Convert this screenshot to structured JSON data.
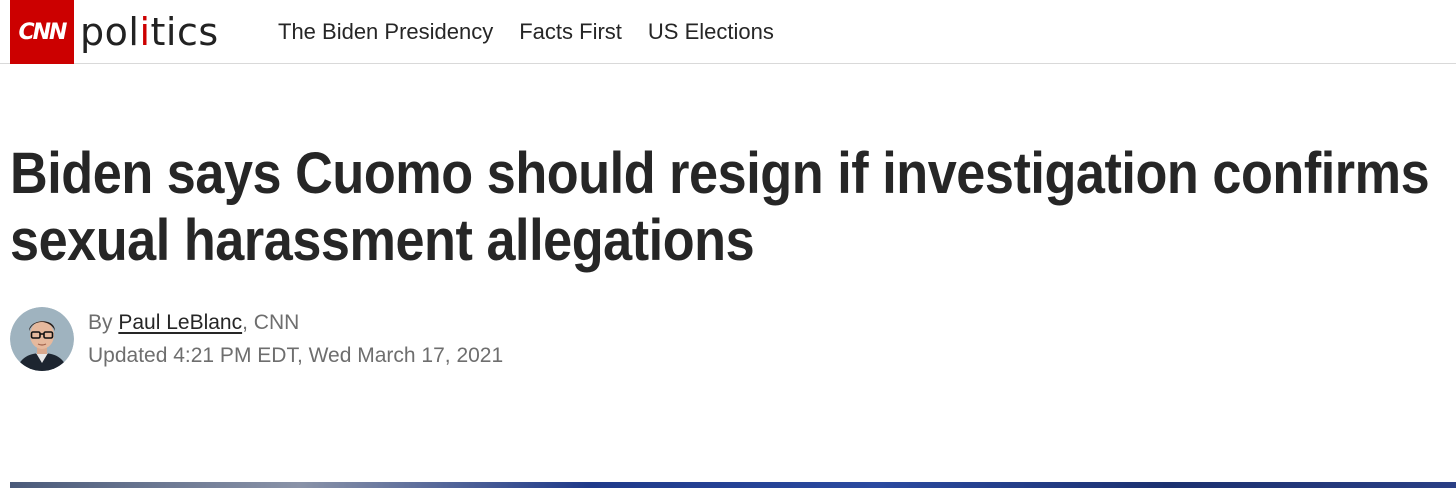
{
  "header": {
    "logo_text": "CNN",
    "section_prefix": "pol",
    "section_accent": "i",
    "section_suffix": "tics",
    "nav": [
      {
        "label": "The Biden Presidency"
      },
      {
        "label": "Facts First"
      },
      {
        "label": "US Elections"
      }
    ]
  },
  "article": {
    "headline": "Biden says Cuomo should resign if investigation confirms sexual harassment allegations",
    "byline_prefix": "By ",
    "author": "Paul LeBlanc",
    "byline_suffix": ", CNN",
    "updated": "Updated 4:21 PM EDT, Wed March 17, 2021"
  },
  "colors": {
    "brand_red": "#cc0000",
    "text_dark": "#262626",
    "text_muted": "#6e6e6e"
  }
}
